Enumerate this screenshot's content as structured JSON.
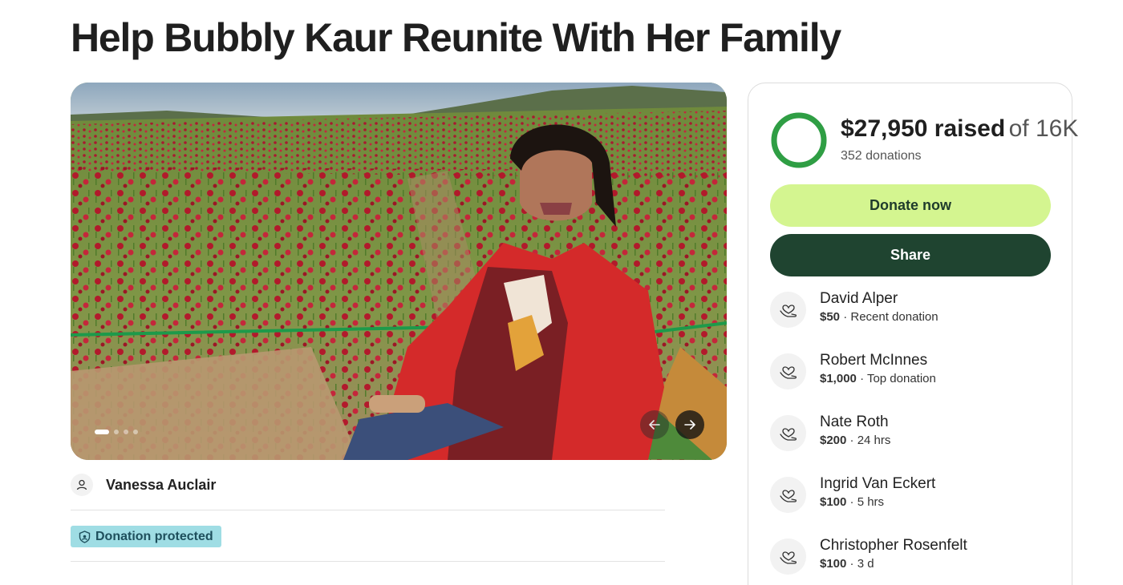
{
  "campaign": {
    "title": "Help Bubbly Kaur Reunite With Her Family"
  },
  "hero": {
    "image_alt": "Woman in a red cardigan sitting on a bench in a field of red flowers",
    "carousel_dots": 4,
    "active_dot": 0,
    "prev_icon": "arrow-left-icon",
    "next_icon": "arrow-right-icon"
  },
  "organizer": {
    "name": "Vanessa Auclair",
    "icon": "user-icon"
  },
  "badge": {
    "label": "Donation protected",
    "icon": "shield-icon",
    "color": "#9fdde4"
  },
  "progress": {
    "raised": "$27,950 raised",
    "goal": "of 16K",
    "donations": "352 donations",
    "percent": 100,
    "ring_color": "#2f9e44"
  },
  "actions": {
    "donate_label": "Donate now",
    "share_label": "Share",
    "donate_color": "#d4f590",
    "share_color": "#1f4430"
  },
  "donors": [
    {
      "name": "David Alper",
      "amount": "$50",
      "note": "· Recent donation"
    },
    {
      "name": "Robert McInnes",
      "amount": "$1,000",
      "note": "· Top donation"
    },
    {
      "name": "Nate Roth",
      "amount": "$200",
      "note": "· 24 hrs"
    },
    {
      "name": "Ingrid Van Eckert",
      "amount": "$100",
      "note": "· 5 hrs"
    },
    {
      "name": "Christopher Rosenfelt",
      "amount": "$100",
      "note": "· 3 d"
    }
  ]
}
